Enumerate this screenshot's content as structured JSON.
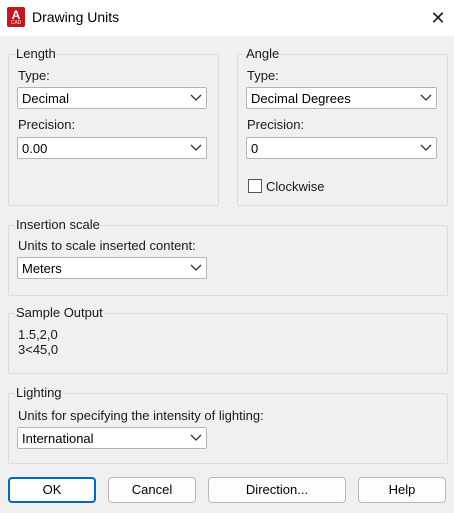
{
  "window": {
    "title": "Drawing Units",
    "icon": "autocad-app-icon",
    "icon_letter": "A",
    "icon_caption": "CAD",
    "close_glyph": "✕"
  },
  "length": {
    "group_label": "Length",
    "type_label": "Type:",
    "type_value": "Decimal",
    "precision_label": "Precision:",
    "precision_value": "0.00"
  },
  "angle": {
    "group_label": "Angle",
    "type_label": "Type:",
    "type_value": "Decimal Degrees",
    "precision_label": "Precision:",
    "precision_value": "0",
    "clockwise_label": "Clockwise",
    "clockwise_checked": false
  },
  "insertion": {
    "group_label": "Insertion scale",
    "units_label": "Units to scale inserted content:",
    "units_value": "Meters"
  },
  "sample": {
    "group_label": "Sample Output",
    "line1": "1.5,2,0",
    "line2": "3<45,0"
  },
  "lighting": {
    "group_label": "Lighting",
    "units_label": "Units for specifying the intensity of lighting:",
    "units_value": "International"
  },
  "buttons": {
    "ok": "OK",
    "cancel": "Cancel",
    "direction": "Direction...",
    "help": "Help"
  },
  "colors": {
    "accent": "#0067c0",
    "icon_red": "#c4161c"
  }
}
